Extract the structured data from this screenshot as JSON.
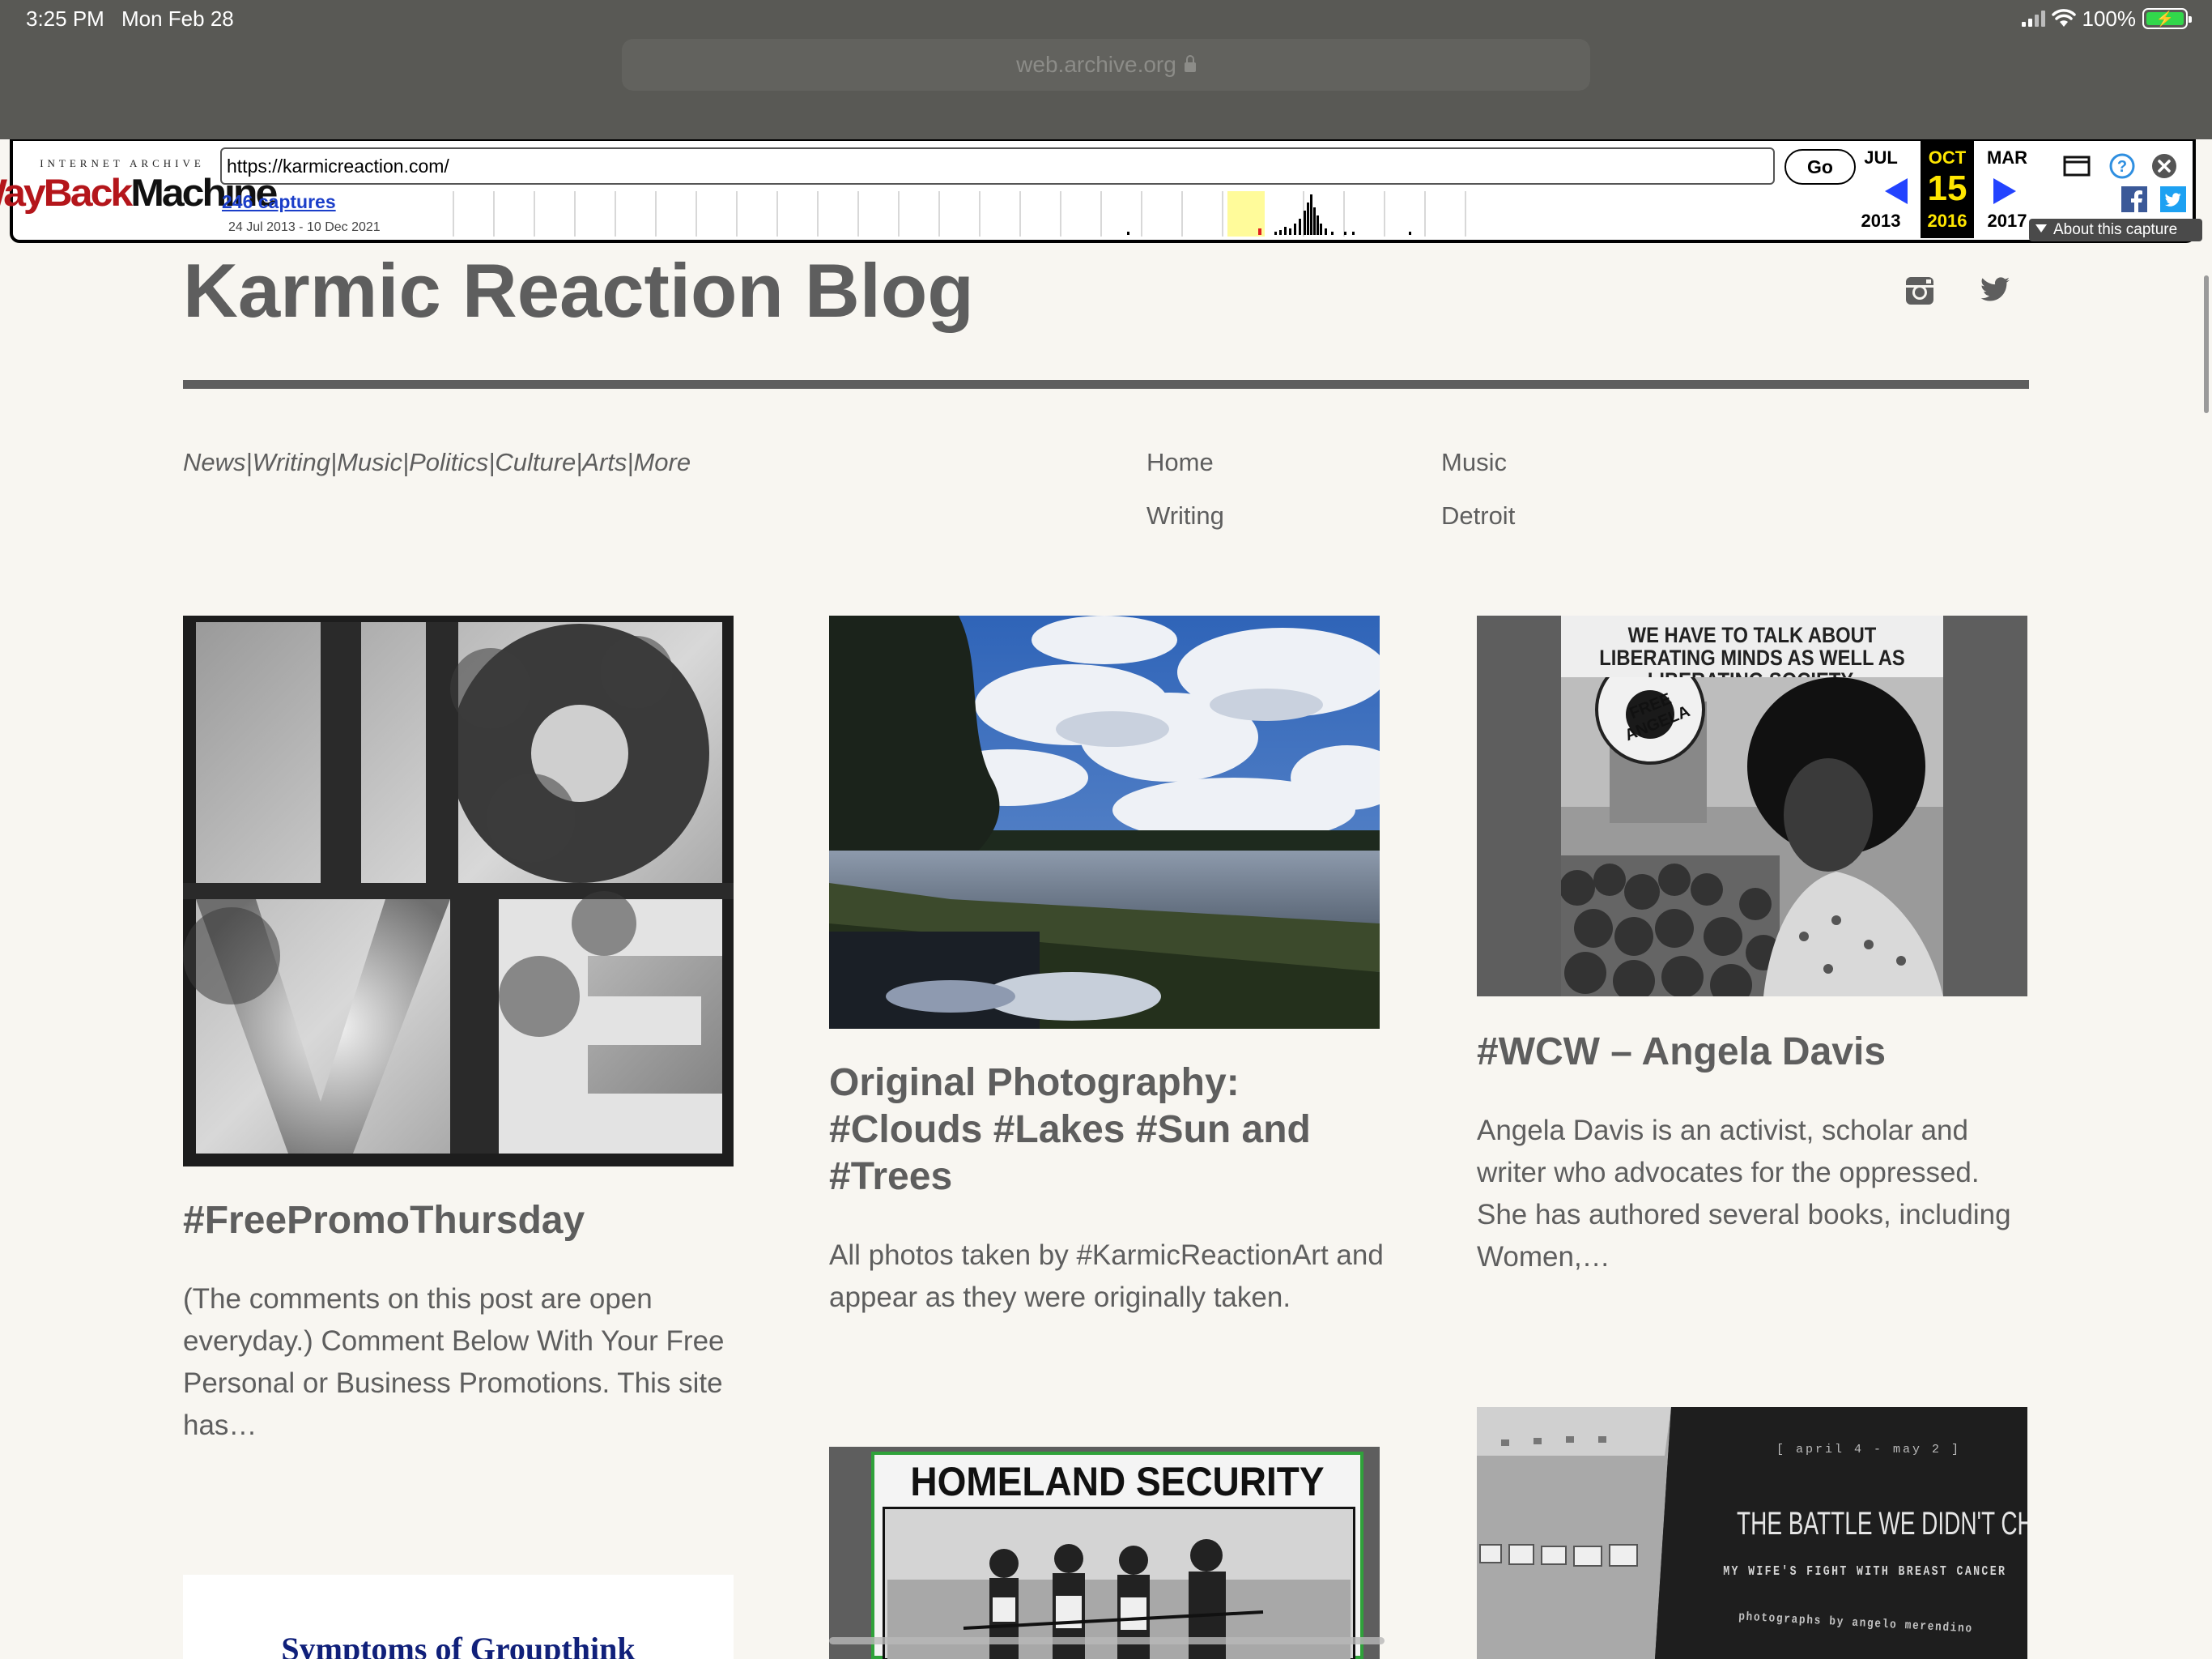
{
  "status_bar": {
    "time": "3:25 PM",
    "date": "Mon Feb 28",
    "battery": "100%",
    "battery_level": 1.0
  },
  "safari": {
    "address": "web.archive.org"
  },
  "wayback": {
    "logo_top": "INTERNET ARCHIVE",
    "logo_a": "WayBack",
    "logo_b": "Machine",
    "url_value": "https://karmicreaction.com/",
    "go_label": "Go",
    "captures_label": "246 captures",
    "date_range": "24 Jul 2013 - 10 Dec 2021",
    "calendar": {
      "prev": {
        "month": "JUL",
        "year": "2013"
      },
      "current": {
        "month": "OCT",
        "day": "15",
        "year": "2016"
      },
      "next": {
        "month": "MAR",
        "year": "2017"
      }
    },
    "about_label": "About this capture",
    "icons": [
      "calendar-window-icon",
      "help-icon",
      "close-icon",
      "facebook-icon",
      "twitter-icon"
    ],
    "colors": {
      "logo_red": "#b4161b",
      "arrow_blue": "#2343ff",
      "highlight": "#fffb9a",
      "current_year": "#ffe600"
    }
  },
  "blog": {
    "title": "Karmic Reaction Blog",
    "tagline": "News|Writing|Music|Politics|Culture|Arts|More",
    "social_icons": [
      "instagram-icon",
      "twitter-icon"
    ],
    "nav": {
      "home": "Home",
      "music": "Music",
      "writing": "Writing",
      "detroit": "Detroit"
    },
    "posts": [
      {
        "title": "#FreePromoThursday",
        "excerpt": "(The comments on this post are open everyday.) Comment Below With Your Free Personal or Business Promotions. This site has…",
        "image_text": "LOVE"
      },
      {
        "title": "Original Photography: #Clouds #Lakes #Sun and #Trees",
        "excerpt": "All photos taken by #KarmicReactionArt and appear as they were originally taken."
      },
      {
        "title": "#WCW – Angela Davis",
        "excerpt": "Angela Davis is an activist, scholar and writer who advocates for the oppressed. She has authored several books, including Women,…",
        "image_quote": "WE HAVE TO TALK ABOUT LIBERATING MINDS AS WELL AS LIBERATING SOCIETY.",
        "image_button": "FREE ANGELA"
      }
    ],
    "lower_cards": [
      {
        "image_text": "Symptoms of Groupthink"
      },
      {
        "image_text": "HOMELAND SECURITY"
      },
      {
        "image_top": "[ april 4 - may 2 ]",
        "image_title": "THE BATTLE WE DIDN'T CHOOSE",
        "image_sub": "MY WIFE'S FIGHT WITH BREAST CANCER",
        "image_credit": "photographs by angelo merendino"
      }
    ]
  }
}
